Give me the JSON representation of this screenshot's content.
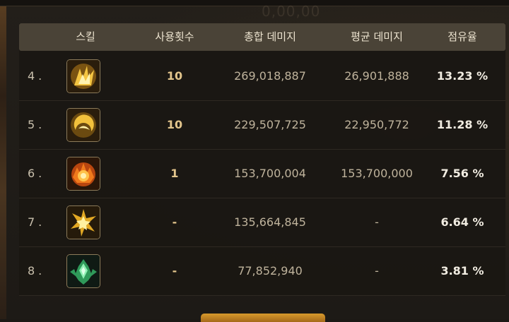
{
  "faded_title": "0,00,00",
  "header": {
    "skill": "스킬",
    "uses": "사용횟수",
    "total": "총합 데미지",
    "avg": "평균 데미지",
    "share": "점유율"
  },
  "rows": [
    {
      "rank": "4.",
      "icon": "golden-flame-claw-icon",
      "uses": "10",
      "total": "269,018,887",
      "avg": "26,901,888",
      "share": "13.23 %"
    },
    {
      "rank": "5.",
      "icon": "golden-crescent-slash-icon",
      "uses": "10",
      "total": "229,507,725",
      "avg": "22,950,772",
      "share": "11.28 %"
    },
    {
      "rank": "6.",
      "icon": "fire-explosion-icon",
      "uses": "1",
      "total": "153,700,004",
      "avg": "153,700,000",
      "share": "7.56 %"
    },
    {
      "rank": "7.",
      "icon": "golden-star-burst-icon",
      "uses": "-",
      "total": "135,664,845",
      "avg": "-",
      "share": "6.64 %"
    },
    {
      "rank": "8.",
      "icon": "green-spirit-crystal-icon",
      "uses": "-",
      "total": "77,852,940",
      "avg": "-",
      "share": "3.81 %"
    }
  ]
}
